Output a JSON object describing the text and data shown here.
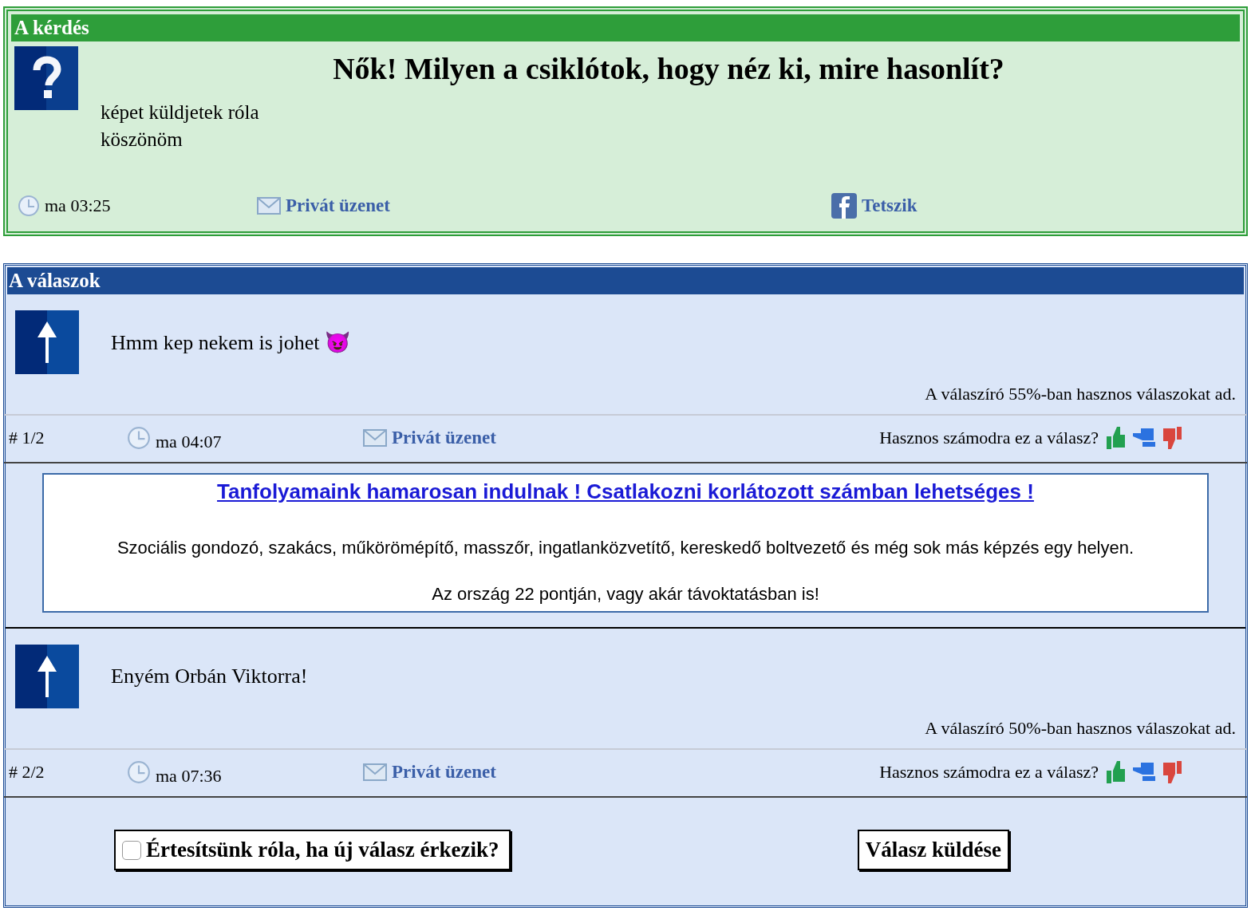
{
  "question": {
    "header": "A kérdés",
    "title": "Nők! Milyen a csiklótok, hogy néz ki, mire hasonlít?",
    "body": [
      "képet küldjetek róla",
      "köszönöm"
    ],
    "time": "ma 03:25",
    "message_link": "Privát üzenet",
    "like_link": "Tetszik"
  },
  "answers_section": {
    "header": "A válaszok",
    "answers": [
      {
        "text": "Hmm kep nekem is johet 😈",
        "rating": "A válaszíró 55%-ban hasznos válaszokat ad.",
        "number": "# 1/2",
        "time": "ma 04:07",
        "message_link": "Privát üzenet",
        "useful_prompt": "Hasznos számodra ez a válasz?"
      },
      {
        "text": "Enyém Orbán Viktorra!",
        "rating": "A válaszíró 50%-ban hasznos válaszokat ad.",
        "number": "# 2/2",
        "time": "ma 07:36",
        "message_link": "Privát üzenet",
        "useful_prompt": "Hasznos számodra ez a válasz?"
      }
    ],
    "ad": {
      "title": "Tanfolyamaink hamarosan indulnak ! Csatlakozni korlátozott számban lehetséges !",
      "lines": [
        "Szociális gondozó, szakács, műkörömépítő, masszőr, ingatlanközvetítő, kereskedő boltvezető és még sok más képzés egy helyen.",
        "Az ország 22 pontján, vagy akár távoktatásban is!"
      ]
    },
    "notify": {
      "label": "Értesítsünk róla, ha új válasz érkezik?",
      "checked": false
    },
    "submit": "Válasz küldése"
  }
}
